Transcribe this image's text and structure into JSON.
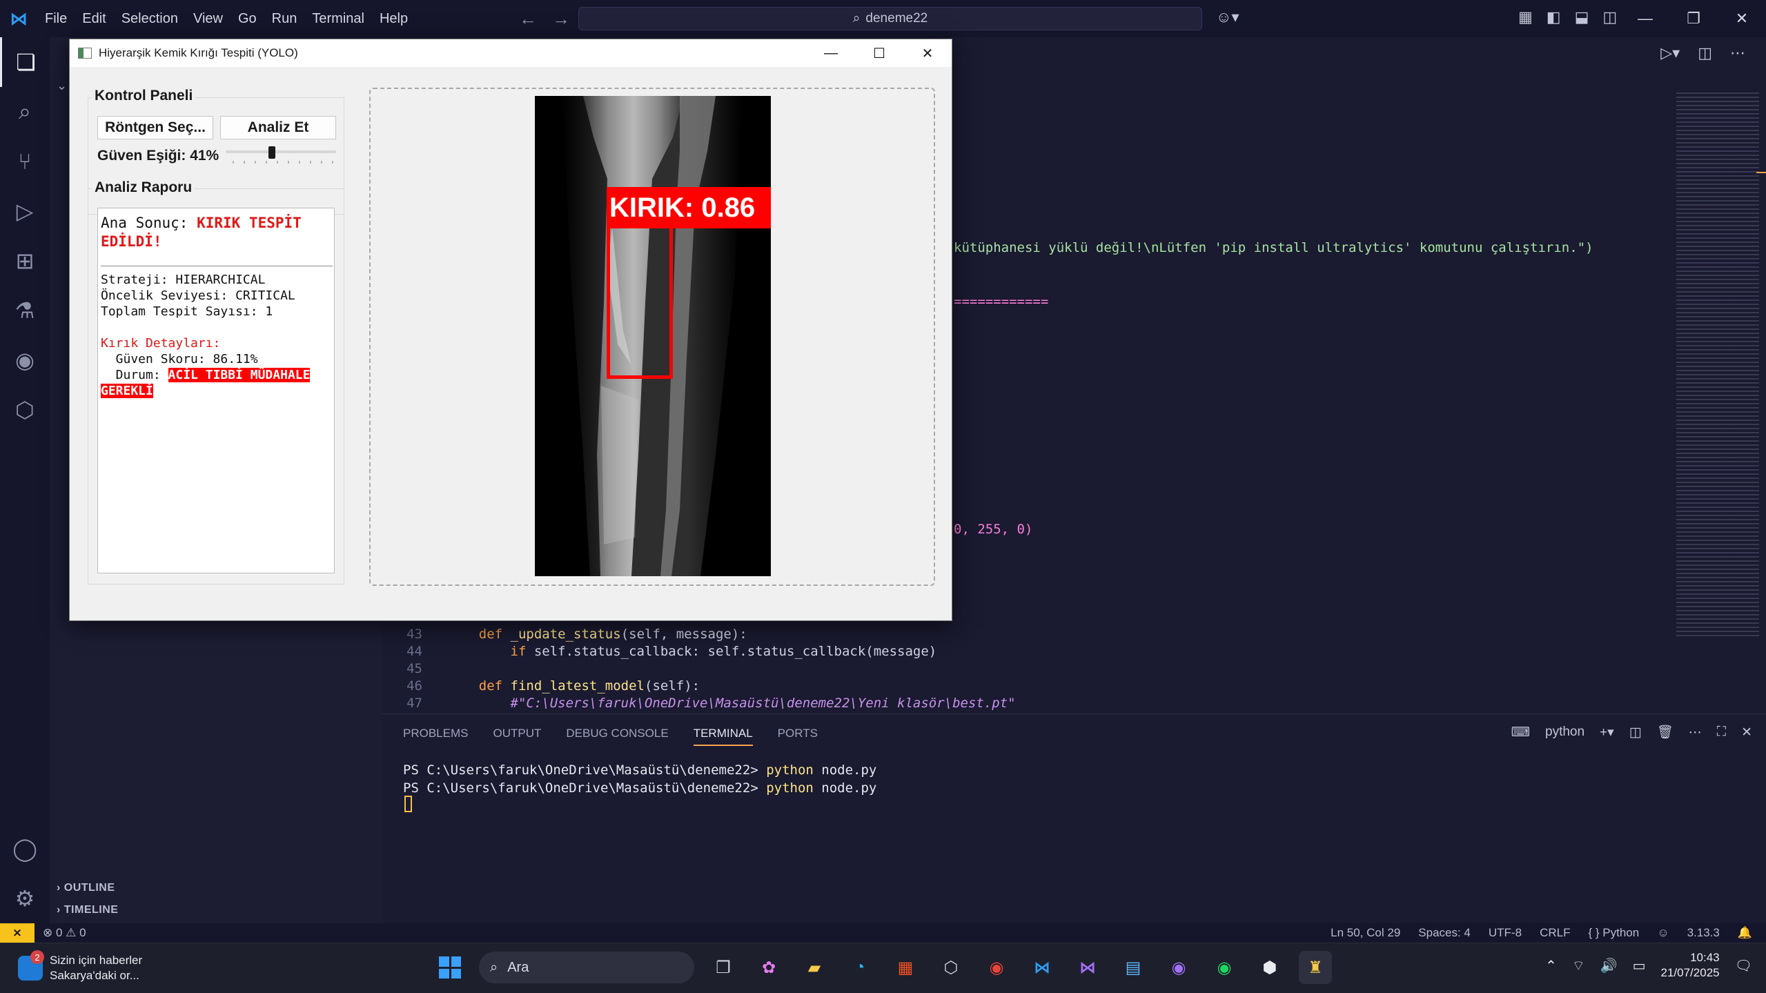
{
  "titlebar": {
    "menu": [
      "File",
      "Edit",
      "Selection",
      "View",
      "Go",
      "Run",
      "Terminal",
      "Help"
    ],
    "search_text": "deneme22"
  },
  "sidebar": {
    "outline_label": "OUTLINE",
    "timeline_label": "TIMELINE"
  },
  "editor": {
    "frag_error_msg": "kütüphanesi yüklü değil!\\nLütfen 'pip install ultralytics' komutunu çalıştırın.\")",
    "frag_separator": "============",
    "frag_color": "0, 255, 0)",
    "lines": [
      {
        "num": "43",
        "indent": "    ",
        "kw": "def ",
        "fn": "_update_status",
        "rest": "(self, message):"
      },
      {
        "num": "44",
        "indent": "        ",
        "kw": "if ",
        "fn": "",
        "rest": "self.status_callback: self.status_callback(message)"
      },
      {
        "num": "45",
        "indent": "",
        "kw": "",
        "fn": "",
        "rest": ""
      },
      {
        "num": "46",
        "indent": "    ",
        "kw": "def ",
        "fn": "find_latest_model",
        "rest": "(self):"
      }
    ],
    "line47_num": "47",
    "line47_comment": "#\"C:\\Users\\faruk\\OneDrive\\Masaüstü\\deneme22\\Yeni klasör\\best.pt\""
  },
  "panel": {
    "tabs": [
      "PROBLEMS",
      "OUTPUT",
      "DEBUG CONSOLE",
      "TERMINAL",
      "PORTS"
    ],
    "active_tab": "TERMINAL",
    "shell_label": "python",
    "prompt": "PS C:\\Users\\faruk\\OneDrive\\Masaüstü\\deneme22> ",
    "cmd_python": "python",
    "cmd_arg": " node.py"
  },
  "statusbar": {
    "problems": "⊗ 0 ⚠ 0",
    "position": "Ln 50, Col 29",
    "spaces": "Spaces: 4",
    "encoding": "UTF-8",
    "eol": "CRLF",
    "language": "{ } Python",
    "version": "3.13.3"
  },
  "taskbar": {
    "news_badge": "2",
    "news_title": "Sizin için haberler",
    "news_sub": "Sakarya'daki or...",
    "search_placeholder": "Ara",
    "time": "10:43",
    "date": "21/07/2025"
  },
  "app": {
    "window_title": "Hiyerarşik Kemik Kırığı Tespiti (YOLO)",
    "control_panel_title": "Kontrol Paneli",
    "select_button": "Röntgen Seç...",
    "analyze_button": "Analiz Et",
    "threshold_label": "Güven Eşiği: 41%",
    "threshold_value": 0.41,
    "report_title": "Analiz Raporu",
    "result_label": "Ana Sonuç: ",
    "result_value": "KIRIK TESPİT EDİLDİ!",
    "strategy_line": "Strateji: HIERARCHICAL",
    "priority_line": "Öncelik Seviyesi: CRITICAL",
    "count_line": "Toplam Tespit Sayısı: 1",
    "details_title": "Kırık Detayları:",
    "score_line": "  Güven Skoru: 86.11%",
    "status_label": "  Durum: ",
    "status_value": "ACİL TIBBİ MÜDAHALE GEREKLİ",
    "detection_label": "KIRIK: 0.86"
  },
  "colors": {
    "accent": "#f8a24a",
    "alert_red": "#ff0000",
    "vscode_bg": "#1a1a30"
  }
}
